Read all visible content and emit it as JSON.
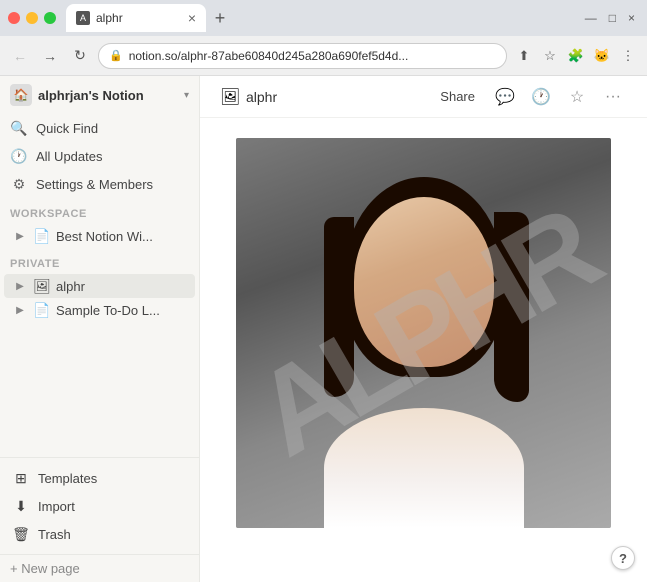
{
  "browser": {
    "tab_title": "alphr",
    "tab_favicon": "A",
    "address": "notion.so/alphr-87abe60840d245a280a690fef5d4d...",
    "new_tab_label": "+",
    "nav": {
      "back_label": "←",
      "forward_label": "→",
      "reload_label": "↻"
    },
    "window_controls": {
      "minimize": "—",
      "maximize": "□",
      "close": "×"
    }
  },
  "sidebar": {
    "workspace_name": "alphrjan's Notion",
    "quick_find_label": "Quick Find",
    "all_updates_label": "All Updates",
    "settings_label": "Settings & Members",
    "workspace_section": "WORKSPACE",
    "private_section": "PRIVATE",
    "workspace_items": [
      {
        "label": "Best Notion Wi..."
      }
    ],
    "private_items": [
      {
        "label": "alphr",
        "active": true
      },
      {
        "label": "Sample To-Do L..."
      }
    ],
    "bottom_items": [
      {
        "label": "Templates",
        "icon": "⊞"
      },
      {
        "label": "Import",
        "icon": "⬇"
      },
      {
        "label": "Trash",
        "icon": "🗑"
      }
    ],
    "new_page_label": "+ New page"
  },
  "page": {
    "icon": "🖼",
    "title": "alphr",
    "share_label": "Share",
    "help_label": "?"
  },
  "watermark": {
    "text": "ALPHR"
  }
}
